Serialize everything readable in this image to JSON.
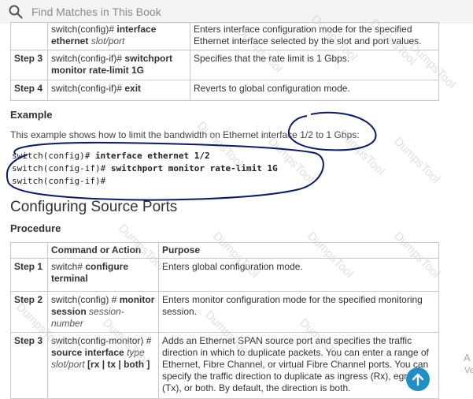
{
  "search": {
    "placeholder": "Find Matches in This Book"
  },
  "top_table": {
    "rows": [
      {
        "step": "",
        "cmd_prefix": "switch(config)# ",
        "cmd_bold": "interface ethernet",
        "cmd_italic": "slot/port",
        "purpose": "Enters interface configuration mode for the specified Ethernet interface selected by the slot and port values."
      },
      {
        "step": "Step 3",
        "cmd_prefix": "switch(config-if)# ",
        "cmd_bold": "switchport monitor rate-limit 1G",
        "purpose": "Specifies that the rate limit is 1 Gbps."
      },
      {
        "step": "Step 4",
        "cmd_prefix": "switch(config-if)# ",
        "cmd_bold": "exit",
        "purpose": "Reverts to global configuration mode."
      }
    ]
  },
  "example": {
    "heading": "Example",
    "text": "This example shows how to limit the bandwidth on Ethernet interface 1/2 to 1 Gbps:",
    "code": [
      {
        "prompt": "switch(config)# ",
        "command": "interface ethernet 1/2"
      },
      {
        "prompt": "switch(config-if)# ",
        "command": "switchport monitor rate-limit 1G"
      },
      {
        "prompt": "switch(config-if)#",
        "command": ""
      }
    ]
  },
  "section": {
    "title": "Configuring Source Ports",
    "procedure": "Procedure"
  },
  "procedure_table": {
    "headers": {
      "command": "Command or Action",
      "purpose": "Purpose"
    },
    "rows": [
      {
        "step": "Step 1",
        "cmd_prefix": "switch# ",
        "cmd_bold": "configure terminal",
        "purpose": "Enters global configuration mode."
      },
      {
        "step": "Step 2",
        "cmd_prefix": "switch(config) # ",
        "cmd_bold": "monitor session",
        "cmd_italic": "session-number",
        "purpose": "Enters monitor configuration mode for the specified monitoring session."
      },
      {
        "step": "Step 3",
        "cmd_prefix": "switch(config-monitor) # ",
        "cmd_bold": "source interface",
        "cmd_italic": "type slot/port",
        "cmd_options": "[rx | tx | both ]",
        "purpose": "Adds an Ethernet SPAN source port and specifies the traffic direction in which to duplicate packets. You can enter a range of Ethernet, Fibre Channel, or virtual Fibre Channel ports. You can specify the traffic direction to duplicate as ingress (Rx), egress (Tx), or both. By default, the direction is both."
      }
    ]
  },
  "watermark": "DumpsTool",
  "side": {
    "glyph": "A",
    "glyph2": "Ve"
  },
  "colors": {
    "annotation_ink": "#0a1a6b",
    "scroll_button": "#1f8fc5",
    "table_border": "#c9c9c9"
  }
}
